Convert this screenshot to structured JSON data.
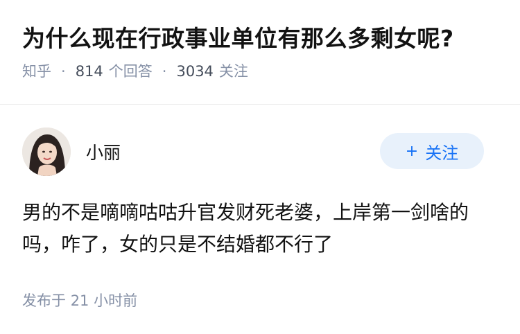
{
  "question": {
    "title": "为什么现在行政事业单位有那么多剩女呢?",
    "source": "知乎",
    "separator": "·",
    "answer_count": "814",
    "answer_label": "个回答",
    "follow_count": "3034",
    "follow_label": "关注"
  },
  "answer": {
    "author_name": "小丽",
    "follow_button_icon": "plus-icon",
    "follow_button_label": "关注",
    "content": "男的不是嘀嘀咕咕升官发财死老婆，上岸第一剑啥的吗，咋了，女的只是不结婚都不行了",
    "time_prefix": "发布于",
    "time_value": "21 小时前"
  },
  "colors": {
    "accent": "#1772f6",
    "follow_button_bg": "#e8f1fb",
    "meta_gray": "#8590a6",
    "text": "#121212"
  }
}
